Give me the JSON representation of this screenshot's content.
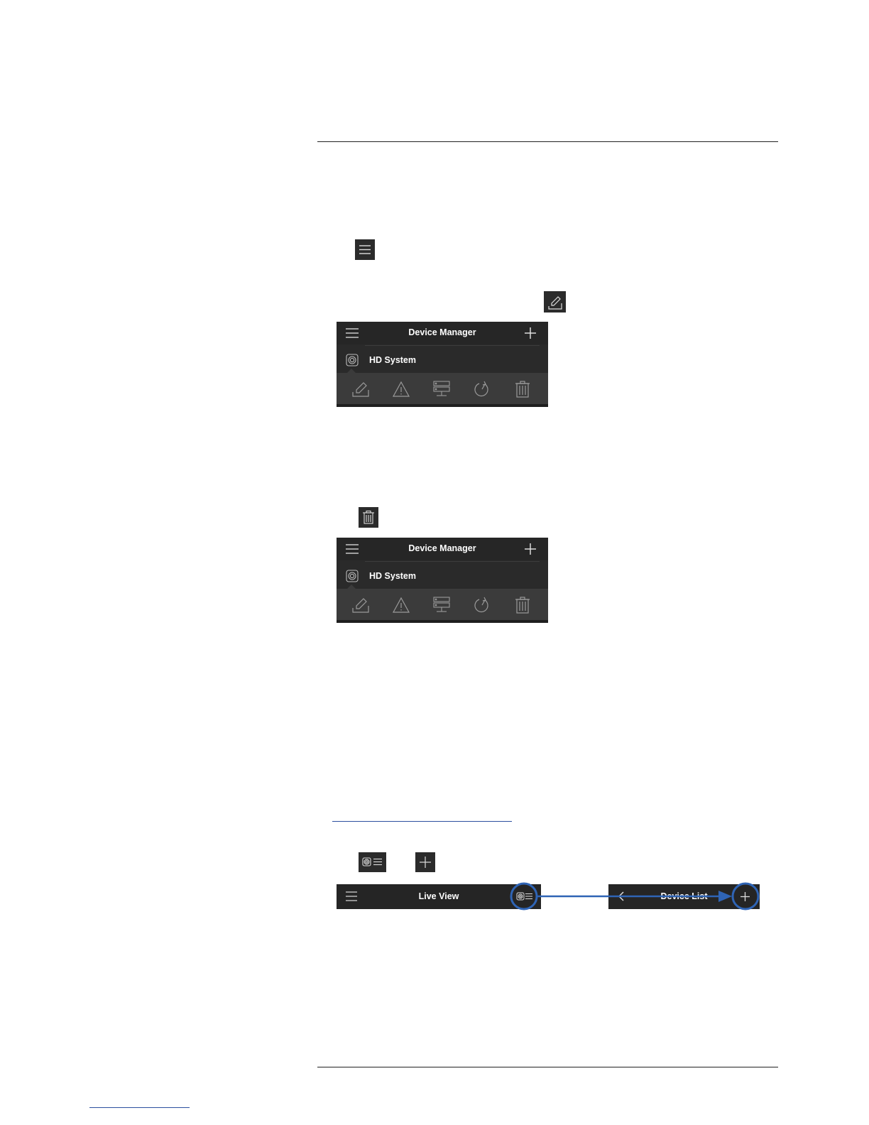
{
  "document": {
    "icons": {
      "menu": "menu-icon",
      "edit": "edit-icon",
      "delete": "trash-icon",
      "device_list": "device-list-icon",
      "add": "plus-icon"
    }
  },
  "device_manager_1": {
    "title": "Device Manager",
    "device_name": "HD System",
    "actions": [
      "edit-icon",
      "alarm-icon",
      "remote-config-icon",
      "playback-icon",
      "trash-icon"
    ]
  },
  "device_manager_2": {
    "title": "Device Manager",
    "device_name": "HD System",
    "actions": [
      "edit-icon",
      "alarm-icon",
      "remote-config-icon",
      "playback-icon",
      "trash-icon"
    ]
  },
  "live_view_bar": {
    "title": "Live View"
  },
  "device_list_bar": {
    "title": "Device List"
  },
  "colors": {
    "panel_bg": "#2a2a2a",
    "action_bar": "#3b3b3b",
    "annotation_blue": "#2f64b5"
  }
}
